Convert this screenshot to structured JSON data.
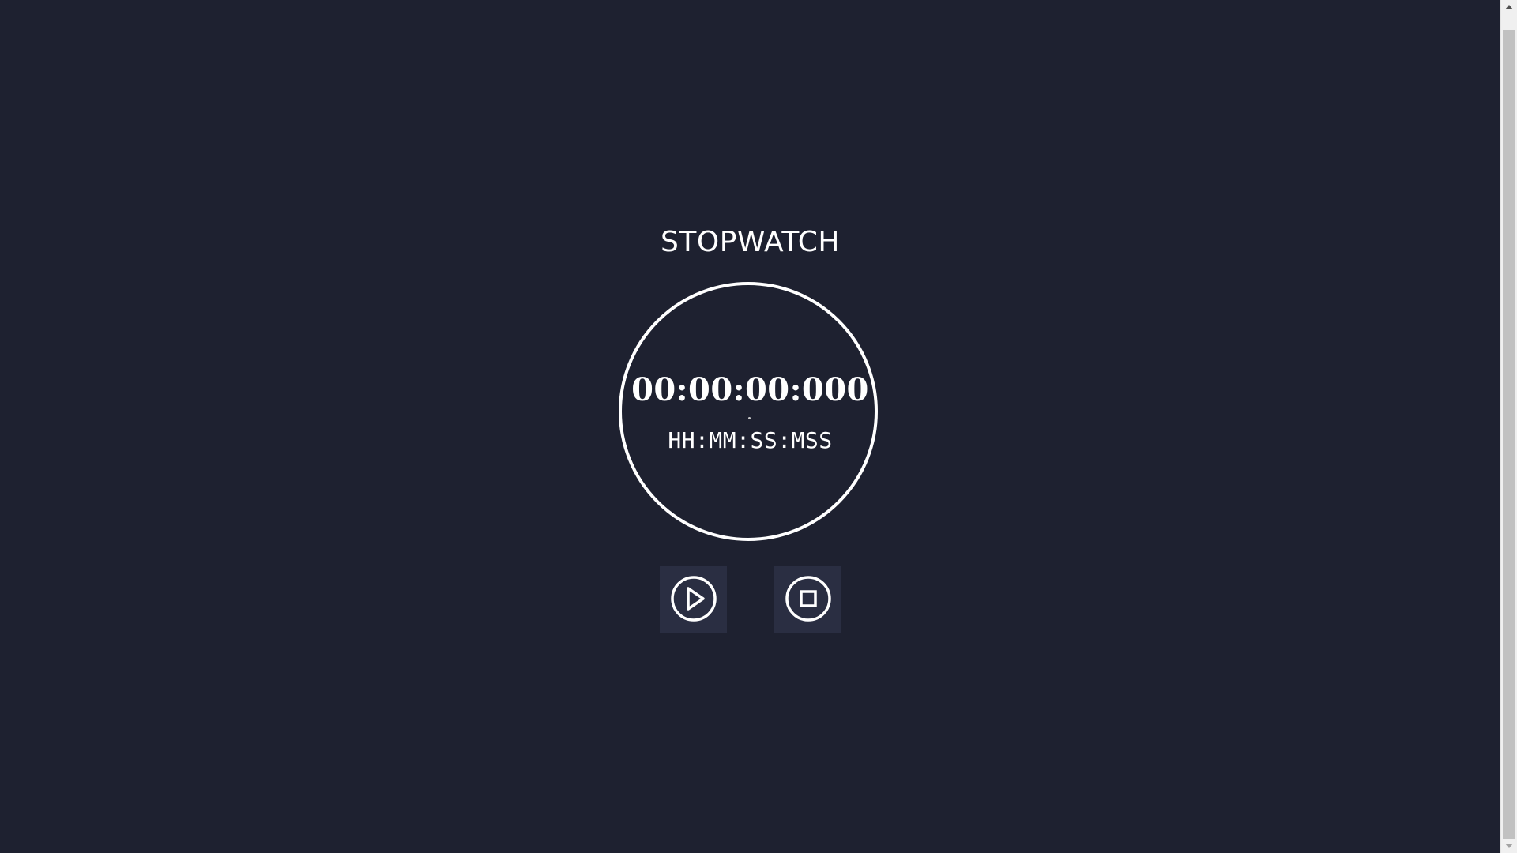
{
  "app": {
    "title": "STOPWATCH"
  },
  "display": {
    "time": "00:00:00:000",
    "format": "HH:MM:SS:MSS"
  },
  "controls": {
    "start_icon": "play-circle-icon",
    "stop_icon": "stop-circle-icon"
  },
  "colors": {
    "background": "#1e2130",
    "button_background": "#2a2e42",
    "foreground": "#ffffff"
  }
}
